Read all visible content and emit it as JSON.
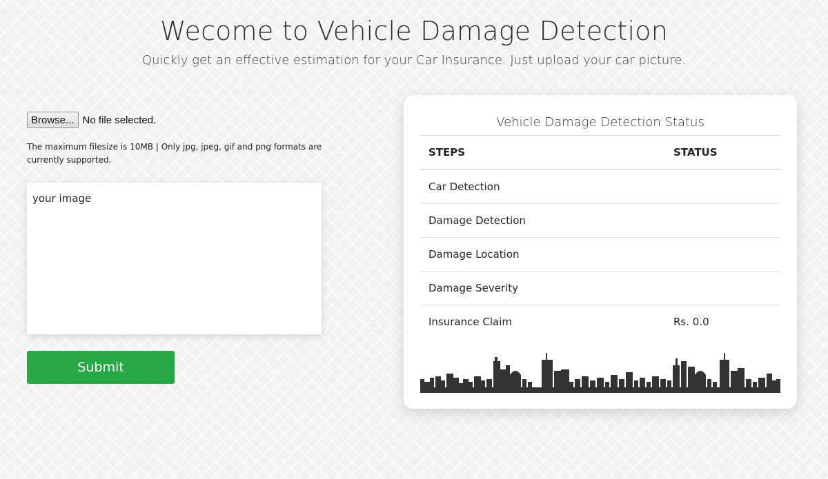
{
  "header": {
    "title": "Wecome to Vehicle Damage Detection",
    "subtitle": "Quickly get an effective estimation for your Car Insurance. Just upload your car picture."
  },
  "upload": {
    "browse_label": "Browse...",
    "file_status": "No file selected.",
    "hint": "The maximum filesize is 10MB | Only jpg, jpeg, gif and png formats are currently supported.",
    "image_placeholder": "your image",
    "submit_label": "Submit"
  },
  "status_card": {
    "title": "Vehicle Damage Detection Status",
    "columns": [
      "STEPS",
      "STATUS"
    ],
    "rows": [
      {
        "step": "Car Detection",
        "status": ""
      },
      {
        "step": "Damage Detection",
        "status": ""
      },
      {
        "step": "Damage Location",
        "status": ""
      },
      {
        "step": "Damage Severity",
        "status": ""
      },
      {
        "step": "Insurance Claim",
        "status": "Rs. 0.0"
      }
    ]
  },
  "colors": {
    "submit_bg": "#28a745",
    "skyline": "#333333",
    "card_bg": "#ffffff"
  }
}
